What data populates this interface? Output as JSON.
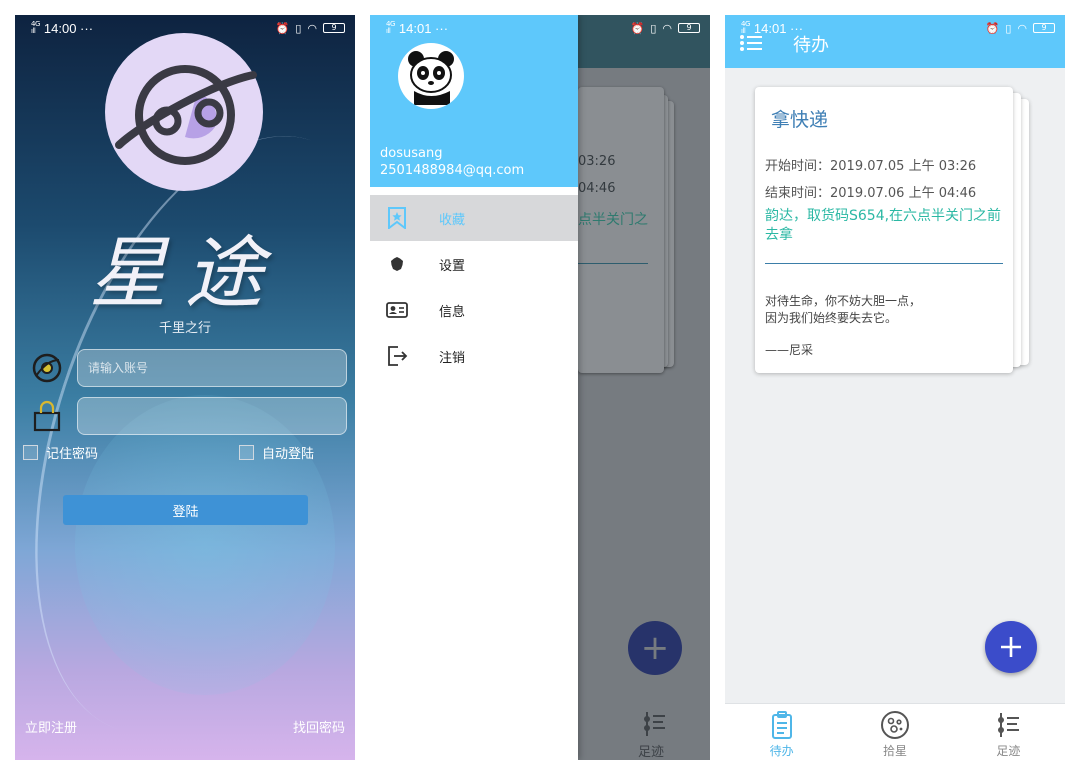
{
  "status": {
    "login": {
      "signal": "4G",
      "time": "14:00 ···",
      "battery": "9"
    },
    "drawer": {
      "signal": "4G",
      "time": "14:01 ···",
      "battery": "9"
    },
    "todo": {
      "signal": "4G",
      "time": "14:01 ···",
      "battery": "9"
    }
  },
  "login": {
    "app_name": "星途",
    "slogan": "千里之行",
    "account_placeholder": "请输入账号",
    "password_placeholder": "",
    "remember_label": "记住密码",
    "auto_login_label": "自动登陆",
    "login_button": "登陆",
    "register_link": "立即注册",
    "forgot_link": "找回密码"
  },
  "drawer": {
    "username": "dosusang",
    "email": "2501488984@qq.com",
    "items": [
      {
        "label": "收藏",
        "icon": "bookmark-star-icon"
      },
      {
        "label": "设置",
        "icon": "gear-icon"
      },
      {
        "label": "信息",
        "icon": "id-card-icon"
      },
      {
        "label": "注销",
        "icon": "logout-icon"
      }
    ],
    "behind": {
      "start_time": "03:26",
      "end_time": "04:46",
      "note_fragment": "点半关门之",
      "tab_label": "足迹"
    }
  },
  "todo": {
    "title": "待办",
    "card": {
      "title": "拿快递",
      "start_label": "开始时间：",
      "start_value": "2019.07.05 上午 03:26",
      "end_label": "结束时间：",
      "end_value": "2019.07.06 上午 04:46",
      "note": "韵达，取货码S654,在六点半关门之前去拿",
      "quote_line1": "对待生命，你不妨大胆一点，",
      "quote_line2": "因为我们始终要失去它。",
      "quote_author": "——尼采"
    },
    "tabs": [
      {
        "label": "待办",
        "icon": "clipboard-icon"
      },
      {
        "label": "拾星",
        "icon": "planet-icon"
      },
      {
        "label": "足迹",
        "icon": "footprint-list-icon"
      }
    ]
  },
  "colors": {
    "accent": "#5ec8fb",
    "fab": "#3b4cca",
    "note": "#2bb8a4",
    "title_blue": "#3f7fb5"
  }
}
